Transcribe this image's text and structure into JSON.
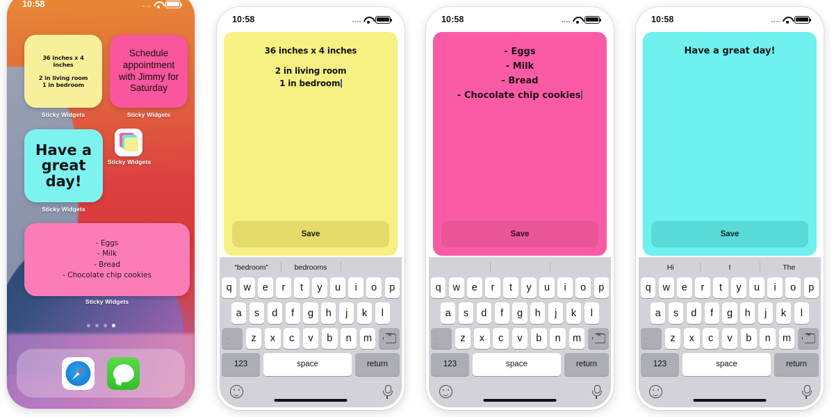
{
  "status_bar": {
    "time": "10:58",
    "wifi_icon": "wifi-icon",
    "battery_icon": "battery-icon",
    "signal_icon": "signal-dots-icon"
  },
  "home_screen": {
    "widget_label": "Sticky Widgets",
    "app_name": "Sticky Widgets",
    "widgets": [
      {
        "name": "measurements-note",
        "color": "#f8ef9a",
        "line1": "36 inches x 4",
        "line2": "inches",
        "line3": "2 in living room",
        "line4": "1 in bedroom"
      },
      {
        "name": "appointment-note",
        "color": "#f9569d",
        "text": "Schedule appointment with Jimmy for Saturday"
      },
      {
        "name": "greeting-note",
        "color": "#7df3f0",
        "text": "Have a great day!"
      },
      {
        "name": "grocery-note",
        "color": "#fb7cb6",
        "items": [
          "- Eggs",
          "- Milk",
          "- Bread",
          "- Chocolate chip cookies"
        ]
      }
    ],
    "page_dots": {
      "count": 4,
      "active_index": 3
    },
    "dock": [
      {
        "name": "safari",
        "label": "Safari"
      },
      {
        "name": "messages",
        "label": "Messages"
      }
    ]
  },
  "editors": [
    {
      "id": "yellow",
      "note_color": "#f7f083",
      "save_label": "Save",
      "lines": [
        "36 inches x 4 inches",
        "2 in living room",
        "1 in bedroom"
      ],
      "caret_after_line": 2,
      "suggestions": [
        "“bedroom”",
        "bedrooms",
        ""
      ]
    },
    {
      "id": "pink",
      "note_color": "#fb5ba4",
      "save_label": "Save",
      "lines": [
        "- Eggs",
        "- Milk",
        "- Bread",
        "- Chocolate chip cookies"
      ],
      "caret_after_line": 3,
      "suggestions": [
        "",
        "",
        ""
      ]
    },
    {
      "id": "cyan",
      "note_color": "#6ff1f0",
      "save_label": "Save",
      "lines": [
        "Have a great day!"
      ],
      "caret_after_line": -1,
      "suggestions": [
        "Hi",
        "I",
        "The"
      ]
    }
  ],
  "keyboard": {
    "row1": [
      "q",
      "w",
      "e",
      "r",
      "t",
      "y",
      "u",
      "i",
      "o",
      "p"
    ],
    "row2": [
      "a",
      "s",
      "d",
      "f",
      "g",
      "h",
      "j",
      "k",
      "l"
    ],
    "row3": [
      "z",
      "x",
      "c",
      "v",
      "b",
      "n",
      "m"
    ],
    "shift_icon": "shift-icon",
    "delete_icon": "delete-backspace-icon",
    "numbers_label": "123",
    "space_label": "space",
    "return_label": "return",
    "emoji_icon": "emoji-smiley-icon",
    "mic_icon": "microphone-icon"
  }
}
